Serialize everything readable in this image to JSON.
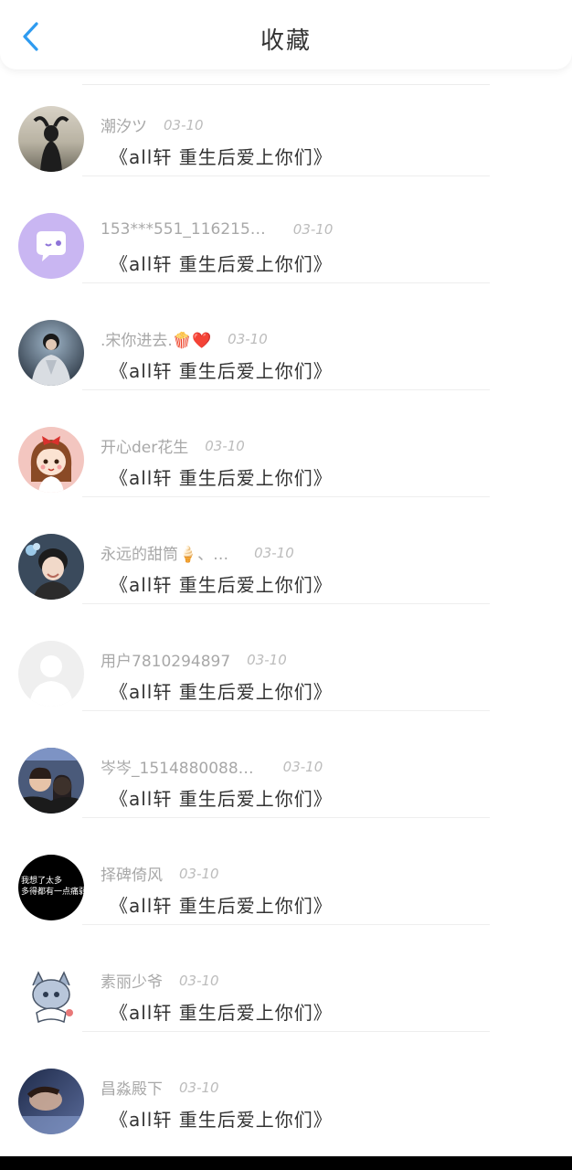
{
  "header": {
    "title": "收藏"
  },
  "items": [
    {
      "username": "潮汐ツ",
      "date": "03-10",
      "book": "《all轩 重生后爱上你们》",
      "avatar_icon": "silhouette-photo-avatar"
    },
    {
      "username": "153***551_116215…",
      "date": "03-10",
      "book": "《all轩 重生后爱上你们》",
      "avatar_icon": "chat-bubble-avatar"
    },
    {
      "username": ".宋你进去.🍿❤️",
      "date": "03-10",
      "book": "《all轩 重生后爱上你们》",
      "avatar_icon": "stage-photo-avatar"
    },
    {
      "username": "开心der花生",
      "date": "03-10",
      "book": "《all轩 重生后爱上你们》",
      "avatar_icon": "cartoon-girl-avatar"
    },
    {
      "username": "永远的甜筒🍦、…",
      "date": "03-10",
      "book": "《all轩 重生后爱上你们》",
      "avatar_icon": "portrait-photo-avatar"
    },
    {
      "username": "用户7810294897",
      "date": "03-10",
      "book": "《all轩 重生后爱上你们》",
      "avatar_icon": "default-user-avatar"
    },
    {
      "username": "岑岑_1514880088…",
      "date": "03-10",
      "book": "《all轩 重生后爱上你们》",
      "avatar_icon": "selfie-photo-avatar"
    },
    {
      "username": "择碑倚风",
      "date": "03-10",
      "book": "《all轩 重生后爱上你们》",
      "avatar_icon": "text-avatar",
      "avatar_text": [
        "我想了太多",
        "多得都有一点痛弱"
      ]
    },
    {
      "username": "素丽少爷",
      "date": "03-10",
      "book": "《all轩 重生后爱上你们》",
      "avatar_icon": "anime-sketch-avatar"
    },
    {
      "username": "昌淼殿下",
      "date": "03-10",
      "book": "《all轩 重生后爱上你们》",
      "avatar_icon": "dark-photo-avatar"
    }
  ],
  "colors": {
    "accent": "#2e9bf0",
    "text": "#333333",
    "muted": "#a8a8a8"
  }
}
